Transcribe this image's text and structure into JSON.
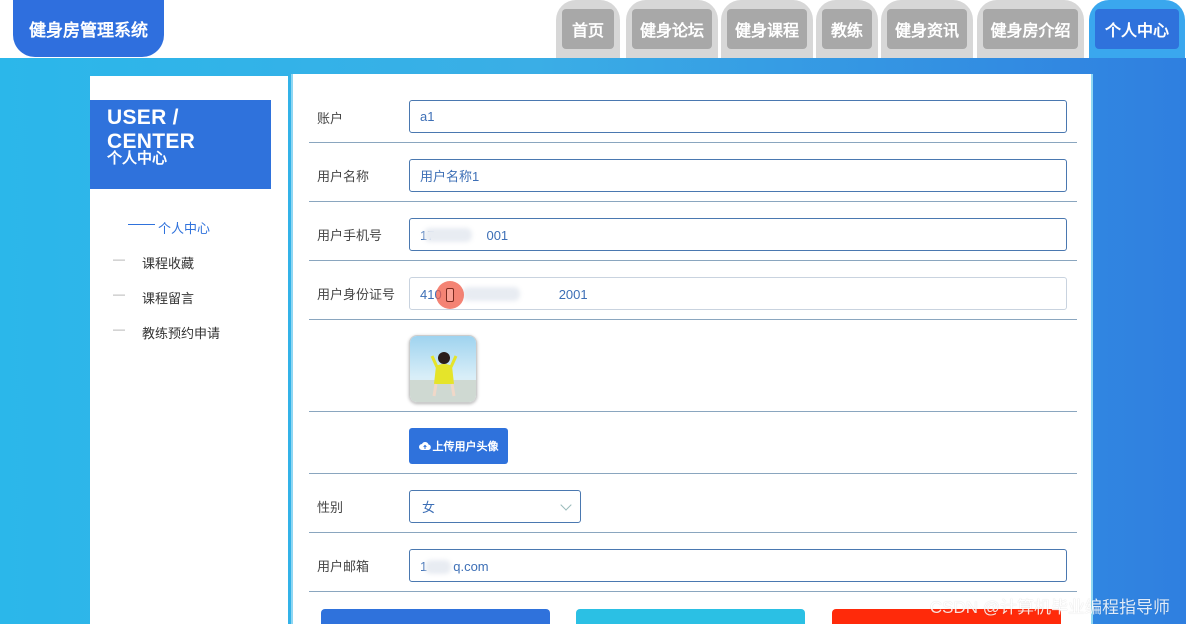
{
  "app": {
    "title": "健身房管理系统"
  },
  "nav": {
    "tabs": [
      {
        "label": "首页"
      },
      {
        "label": "健身论坛"
      },
      {
        "label": "健身课程"
      },
      {
        "label": "教练"
      },
      {
        "label": "健身资讯"
      },
      {
        "label": "健身房介绍"
      },
      {
        "label": "个人中心",
        "active": true
      }
    ]
  },
  "sidebar": {
    "title": "USER / CENTER",
    "subtitle": "个人中心",
    "items": [
      {
        "label": "个人中心",
        "active": true
      },
      {
        "label": "课程收藏"
      },
      {
        "label": "课程留言"
      },
      {
        "label": "教练预约申请"
      }
    ]
  },
  "form": {
    "account": {
      "label": "账户",
      "value": "a1"
    },
    "username": {
      "label": "用户名称",
      "value": "用户名称1"
    },
    "phone": {
      "label": "用户手机号",
      "value": "17　　　　001"
    },
    "idcard": {
      "label": "用户身份证号",
      "value": "410　　　　　　　　　2001"
    },
    "upload_label": "上传用户头像",
    "gender": {
      "label": "性别",
      "value": "女"
    },
    "email": {
      "label": "用户邮箱",
      "value": "1　　q.com"
    }
  },
  "watermark": "CSDN @计算机毕业编程指导师",
  "colors": {
    "primary": "#2f72dc",
    "cyan": "#2bc0e4",
    "red": "#ff2a0a"
  }
}
